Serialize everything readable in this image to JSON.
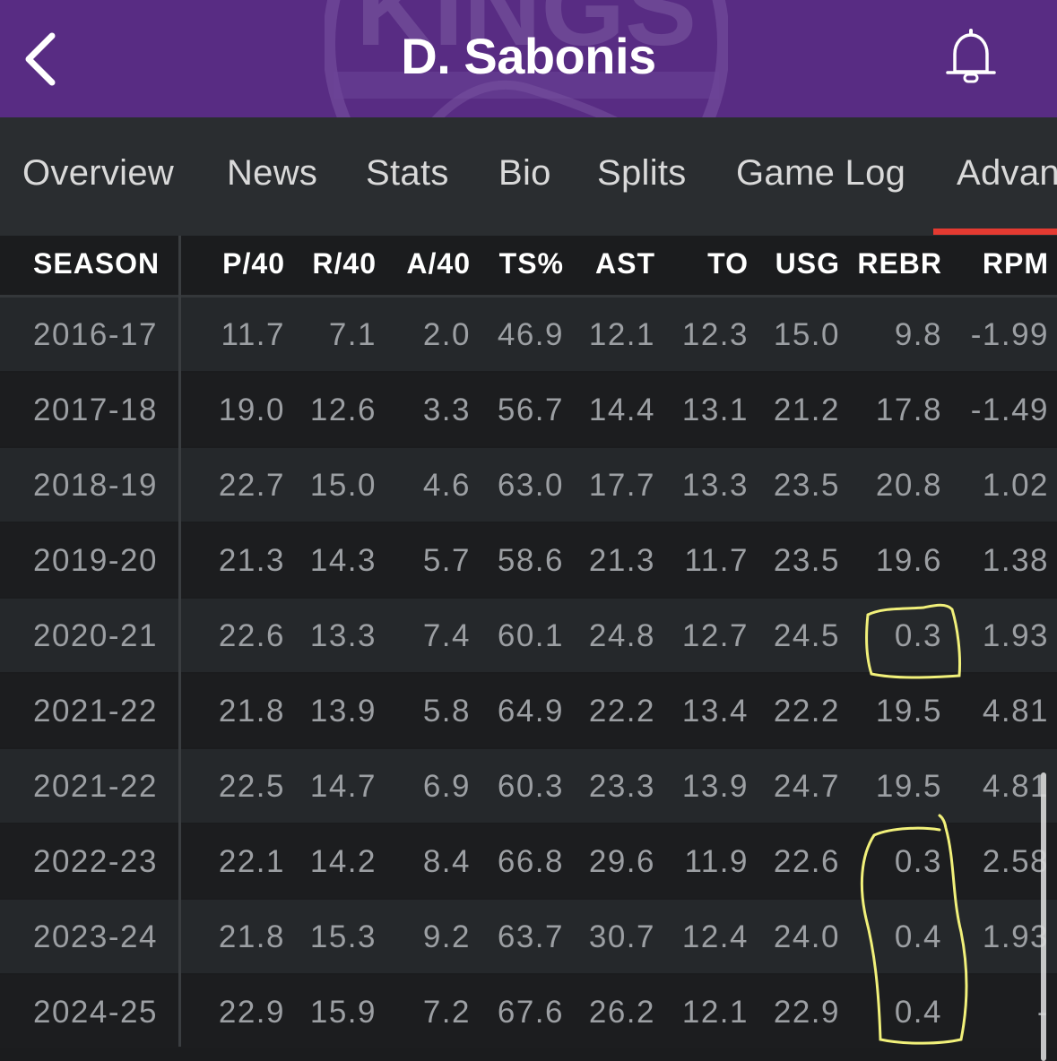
{
  "header": {
    "title": "D. Sabonis",
    "logo_text": "KINGS",
    "back_icon": "chevron-left-icon",
    "bell_icon": "bell-icon",
    "colors": {
      "background": "#582c83",
      "title": "#ffffff"
    }
  },
  "tabs": [
    {
      "label": "Overview"
    },
    {
      "label": "News"
    },
    {
      "label": "Stats"
    },
    {
      "label": "Bio"
    },
    {
      "label": "Splits"
    },
    {
      "label": "Game Log"
    },
    {
      "label": "Advan",
      "active": true
    }
  ],
  "table": {
    "headers": [
      "SEASON",
      "P/40",
      "R/40",
      "A/40",
      "TS%",
      "AST",
      "TO",
      "USG",
      "REBR",
      "RPM"
    ],
    "rows": [
      [
        "2016-17",
        "11.7",
        "7.1",
        "2.0",
        "46.9",
        "12.1",
        "12.3",
        "15.0",
        "9.8",
        "-1.99"
      ],
      [
        "2017-18",
        "19.0",
        "12.6",
        "3.3",
        "56.7",
        "14.4",
        "13.1",
        "21.2",
        "17.8",
        "-1.49"
      ],
      [
        "2018-19",
        "22.7",
        "15.0",
        "4.6",
        "63.0",
        "17.7",
        "13.3",
        "23.5",
        "20.8",
        "1.02"
      ],
      [
        "2019-20",
        "21.3",
        "14.3",
        "5.7",
        "58.6",
        "21.3",
        "11.7",
        "23.5",
        "19.6",
        "1.38"
      ],
      [
        "2020-21",
        "22.6",
        "13.3",
        "7.4",
        "60.1",
        "24.8",
        "12.7",
        "24.5",
        "0.3",
        "1.93"
      ],
      [
        "2021-22",
        "21.8",
        "13.9",
        "5.8",
        "64.9",
        "22.2",
        "13.4",
        "22.2",
        "19.5",
        "4.81"
      ],
      [
        "2021-22",
        "22.5",
        "14.7",
        "6.9",
        "60.3",
        "23.3",
        "13.9",
        "24.7",
        "19.5",
        "4.81"
      ],
      [
        "2022-23",
        "22.1",
        "14.2",
        "8.4",
        "66.8",
        "29.6",
        "11.9",
        "22.6",
        "0.3",
        "2.58"
      ],
      [
        "2023-24",
        "21.8",
        "15.3",
        "9.2",
        "63.7",
        "30.7",
        "12.4",
        "24.0",
        "0.4",
        "1.93"
      ],
      [
        "2024-25",
        "22.9",
        "15.9",
        "7.2",
        "67.6",
        "26.2",
        "12.1",
        "22.9",
        "0.4",
        "-"
      ]
    ]
  },
  "colors": {
    "accent_indicator": "#e43a31",
    "annotation": "#f1f07a",
    "cell_text": "#9c9fa3",
    "header_text": "#ffffff"
  }
}
